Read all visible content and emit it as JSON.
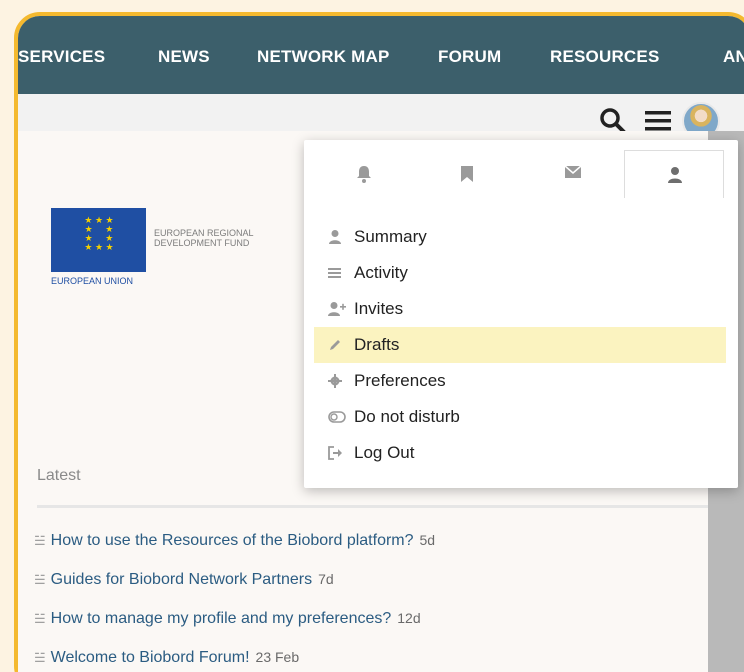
{
  "nav": {
    "items": [
      "SERVICES",
      "NEWS",
      "NETWORK MAP",
      "FORUM",
      "RESOURCES",
      "AN"
    ]
  },
  "eu": {
    "fund": "EUROPEAN REGIONAL DEVELOPMENT FUND",
    "union": "EUROPEAN UNION"
  },
  "latest": {
    "label": "Latest",
    "topics": [
      {
        "title": "How to use the Resources of the Biobord platform?",
        "age": "5d"
      },
      {
        "title": "Guides for Biobord Network Partners",
        "age": "7d"
      },
      {
        "title": "How to manage my profile and my preferences?",
        "age": "12d"
      },
      {
        "title": "Welcome to Biobord Forum!",
        "age": "23 Feb"
      }
    ]
  },
  "user_menu": {
    "tabs": [
      "notifications-tab",
      "bookmarks-tab",
      "messages-tab",
      "profile-tab"
    ],
    "items": [
      {
        "label": "Summary",
        "icon": "user-icon"
      },
      {
        "label": "Activity",
        "icon": "list-icon"
      },
      {
        "label": "Invites",
        "icon": "user-plus-icon"
      },
      {
        "label": "Drafts",
        "icon": "pencil-icon"
      },
      {
        "label": "Preferences",
        "icon": "gear-icon"
      },
      {
        "label": "Do not disturb",
        "icon": "toggle-off-icon"
      },
      {
        "label": "Log Out",
        "icon": "sign-out-icon"
      }
    ]
  },
  "colors": {
    "navbar": "#3c5f6b",
    "frame_border": "#f4b92f",
    "highlight": "#fbf3c0",
    "link": "#2b5c82"
  }
}
